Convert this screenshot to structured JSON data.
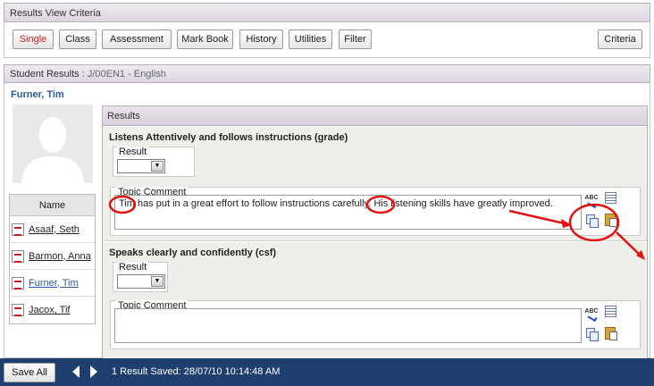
{
  "criteria_panel": {
    "title": "Results View Criteria",
    "buttons": [
      {
        "label": "Single",
        "active": true
      },
      {
        "label": "Class"
      },
      {
        "label": "Assessment"
      },
      {
        "label": "Mark Book"
      },
      {
        "label": "History"
      },
      {
        "label": "Utilities"
      },
      {
        "label": "Filter"
      }
    ],
    "criteria_button": "Criteria"
  },
  "student_panel": {
    "title": "Student Results",
    "subtitle": ": J/00EN1 - English",
    "student_name": "Furner, Tim",
    "name_list_header": "Name",
    "names": [
      "Asaaf, Seth",
      "Barmon, Anna",
      "Furner, Tim",
      "Jacox, Tif"
    ],
    "current_name": "Furner, Tim"
  },
  "results": {
    "title": "Results",
    "sections": [
      {
        "heading": "Listens Attentively and follows instructions  (grade)",
        "result_label": "Result",
        "result_value": "",
        "comment_label": "Topic Comment",
        "comment_text": "Tim has put in a great effort to follow instructions carefully. His listening skills have greatly improved."
      },
      {
        "heading": "Speaks clearly and confidently  (csf)",
        "result_label": "Result",
        "result_value": "",
        "comment_label": "Topic Comment",
        "comment_text": ""
      }
    ],
    "spellcheck_icon_text": "ABC"
  },
  "footer": {
    "save_all_label": "Save All",
    "status_text": "1 Result Saved: 28/07/10 10:14:48 AM"
  },
  "colors": {
    "footer_bg": "#1f3f6e",
    "active_button_text": "#c8201f",
    "annotation_red": "#e01010",
    "link_blue": "#2a5d9a"
  },
  "icons": [
    "spellcheck-icon",
    "comment-list-icon",
    "copy-icon",
    "paste-icon",
    "pdf-report-icon",
    "prev-arrow-icon",
    "next-arrow-icon"
  ]
}
